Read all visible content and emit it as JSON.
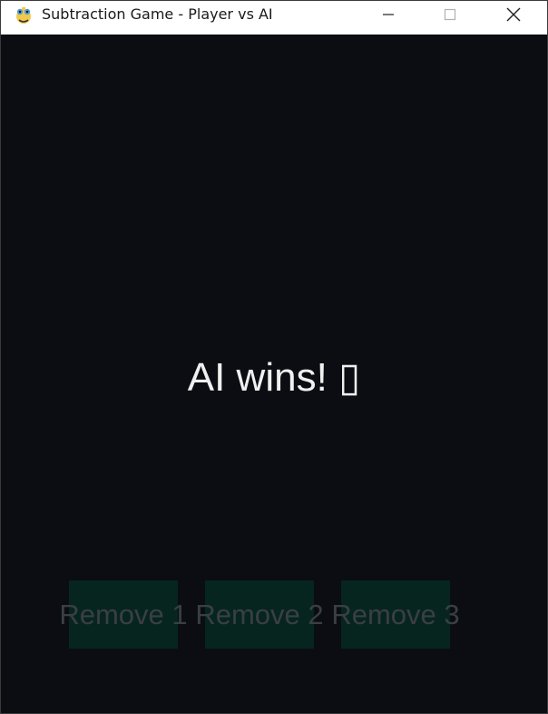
{
  "window": {
    "title": "Subtraction Game - Player vs AI",
    "app_icon": "python-snake-icon",
    "controls": {
      "minimize_icon": "minimize-icon",
      "maximize_icon": "maximize-icon",
      "close_icon": "close-icon"
    }
  },
  "game": {
    "result_text": "AI wins! ▯",
    "buttons": [
      {
        "label": "Remove 1"
      },
      {
        "label": "Remove 2"
      },
      {
        "label": "Remove 3"
      }
    ]
  },
  "colors": {
    "background": "#0b0d12",
    "button_bg": "#06251f",
    "button_text": "#3a3f44",
    "result_text": "#f0f0f0"
  }
}
